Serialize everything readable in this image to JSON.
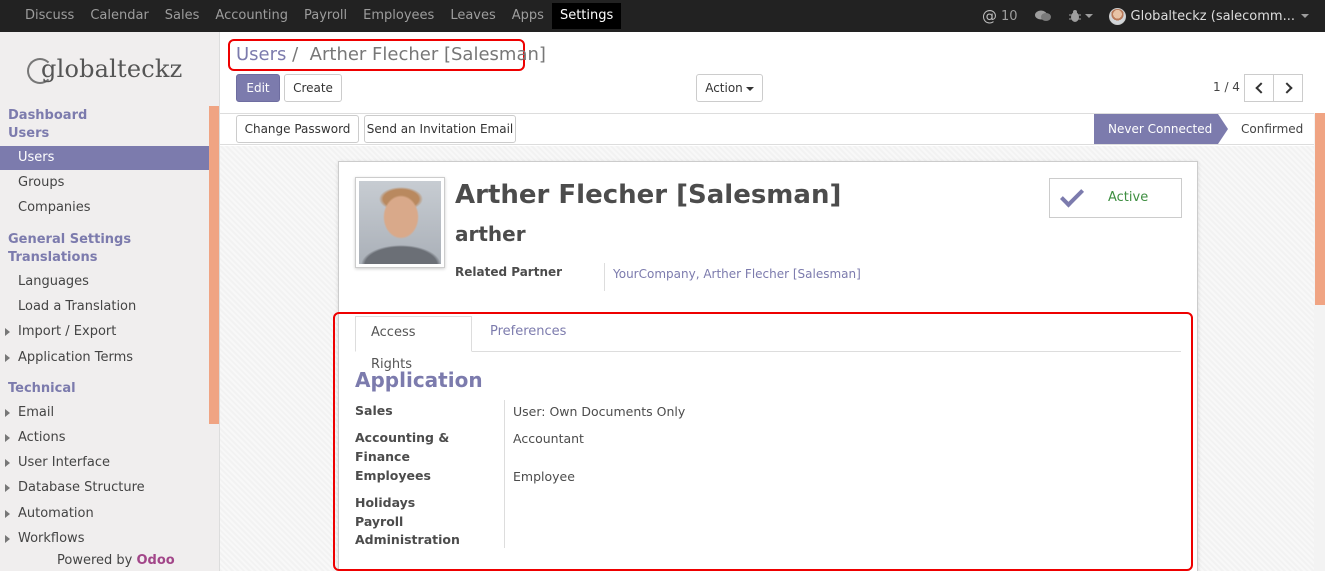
{
  "topnav": {
    "items": [
      "Discuss",
      "Calendar",
      "Sales",
      "Accounting",
      "Payroll",
      "Employees",
      "Leaves",
      "Apps",
      "Settings"
    ],
    "active": "Settings",
    "messages_count": "10",
    "user_label": "Globalteckz (salecomm..."
  },
  "sidebar": {
    "logo_text": "globalteckz",
    "sections": {
      "dashboard": "Dashboard",
      "users": "Users",
      "general_settings": "General Settings",
      "translations": "Translations",
      "technical": "Technical"
    },
    "items": {
      "users": "Users",
      "groups": "Groups",
      "companies": "Companies",
      "languages": "Languages",
      "load_translation": "Load a Translation",
      "import_export": "Import / Export",
      "application_terms": "Application Terms",
      "email": "Email",
      "actions": "Actions",
      "user_interface": "User Interface",
      "database_structure": "Database Structure",
      "automation": "Automation",
      "workflows": "Workflows"
    },
    "powered_by": "Powered by",
    "powered_brand": "Odoo"
  },
  "control": {
    "breadcrumb_root": "Users",
    "breadcrumb_sep": "/",
    "breadcrumb_current": "Arther Flecher [Salesman]",
    "edit_label": "Edit",
    "create_label": "Create",
    "action_label": "Action",
    "pager": "1 / 4"
  },
  "statusbar": {
    "change_password": "Change Password",
    "send_invitation": "Send an Invitation Email",
    "status_current": "Never Connected",
    "status_next": "Confirmed"
  },
  "form": {
    "name": "Arther Flecher [Salesman]",
    "login": "arther",
    "related_partner_label": "Related Partner",
    "related_partner_value": "YourCompany, Arther Flecher [Salesman]",
    "active_label": "Active",
    "tabs": {
      "access_rights": "Access Rights",
      "preferences": "Preferences"
    },
    "section_title": "Application",
    "fields": {
      "sales_label": "Sales",
      "sales_value": "User: Own Documents Only",
      "accounting_label_1": "Accounting &",
      "accounting_label_2": "Finance",
      "accounting_value": "Accountant",
      "employees_label": "Employees",
      "employees_value": "Employee",
      "holidays_label": "Holidays",
      "payroll_label": "Payroll",
      "administration_label": "Administration"
    }
  },
  "colors": {
    "brand": "#7c7bad",
    "topbar": "#222222",
    "highlight": "#ee0000",
    "active_green": "#3e8e41"
  }
}
